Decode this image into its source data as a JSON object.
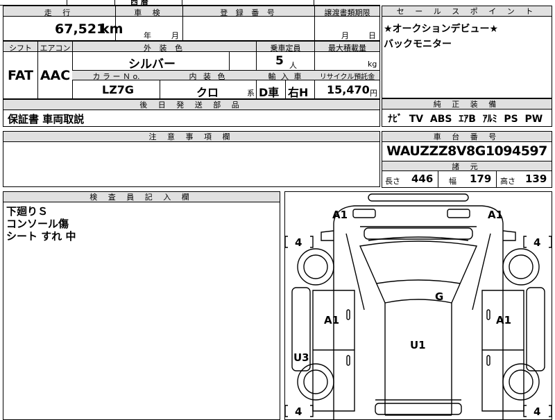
{
  "top_row": {
    "mileage_label": "走 行",
    "inspection_label": "車 検",
    "registration_label": "登 録 番 号",
    "transfer_deadline_label": "譲渡書類期限",
    "mileage_value": "67,521",
    "mileage_unit": "km",
    "year_unit": "年",
    "month_unit": "月",
    "day_unit": "日",
    "top_partial_text": "西 暦"
  },
  "spec_row": {
    "shift_label": "シフト",
    "aircon_label": "エアコン",
    "exterior_color_label": "外 装 色",
    "capacity_label": "乗車定員",
    "max_load_label": "最大積載量",
    "shift_value": "FAT",
    "aircon_value": "AAC",
    "exterior_color_value": "シルバー",
    "capacity_value": "5",
    "capacity_unit": "人",
    "max_load_unit": "kg",
    "color_no_label": "カ ラ ー Ｎ o.",
    "interior_color_label": "内 装 色",
    "import_label": "輸 入 車",
    "recycle_label": "リサイクル預託金",
    "color_no_value": "LZ7G",
    "interior_color_value": "クロ",
    "interior_color_suffix": "系",
    "import_value_1": "D車",
    "import_value_2": "右H",
    "recycle_value": "15,470",
    "recycle_unit": "円"
  },
  "later_parts": {
    "label": "後 日 発 送 部 品",
    "value": "保証書 車両取説"
  },
  "notes": {
    "label": "注 意 事 項 欄"
  },
  "inspector": {
    "label": "検 査 員 記 入 欄",
    "lines": [
      "下廻りＳ",
      "コンソール傷",
      "シート すれ 中"
    ]
  },
  "sales_points": {
    "label": "セ ー ル ス ポ イ ン ト",
    "lines": [
      "★オークションデビュー★",
      "バックモニター"
    ]
  },
  "equipment": {
    "label": "純 正 装 備",
    "value": "ﾅﾋﾞ  TV  ABS  ｴｱB  ｱﾙﾐ  PS  PW"
  },
  "chassis": {
    "label": "車 台 番 号",
    "value": "WAUZZZ8V8G1094597"
  },
  "dimensions": {
    "label": "諸 元",
    "length_label": "長さ",
    "length_value": "446",
    "width_label": "幅",
    "width_value": "179",
    "height_label": "高さ",
    "height_value": "139"
  },
  "diagram": {
    "marks": {
      "front_left": "A1",
      "front_right": "A1",
      "tire_fl": "4",
      "tire_fr": "4",
      "tire_rl": "4",
      "tire_rr": "4",
      "roof": "G",
      "door_left": "A1",
      "door_right": "A1",
      "center": "U1",
      "rear_left": "U3"
    }
  }
}
